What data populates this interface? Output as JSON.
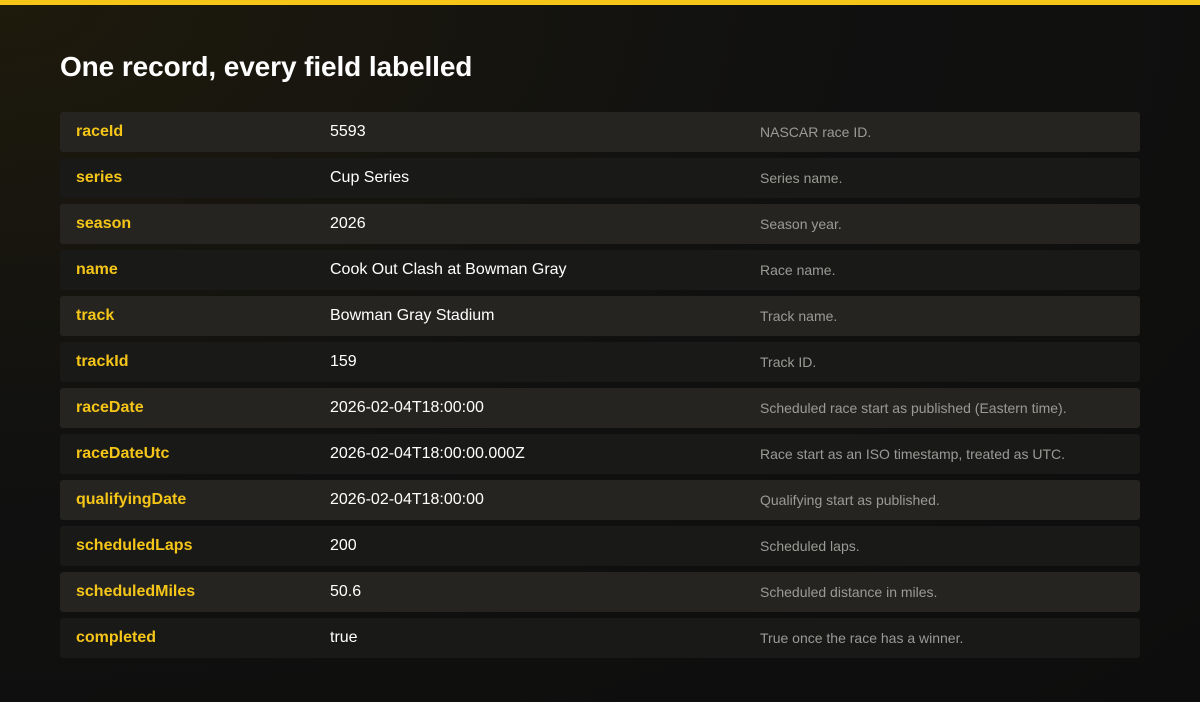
{
  "page": {
    "title": "One record, every field labelled",
    "accent_color": "#f5c518"
  },
  "record": {
    "rows": [
      {
        "key": "raceId",
        "value": "5593",
        "description": "NASCAR race ID."
      },
      {
        "key": "series",
        "value": "Cup Series",
        "description": "Series name."
      },
      {
        "key": "season",
        "value": "2026",
        "description": "Season year."
      },
      {
        "key": "name",
        "value": "Cook Out Clash at Bowman Gray",
        "description": "Race name."
      },
      {
        "key": "track",
        "value": "Bowman Gray Stadium",
        "description": "Track name."
      },
      {
        "key": "trackId",
        "value": "159",
        "description": "Track ID."
      },
      {
        "key": "raceDate",
        "value": "2026-02-04T18:00:00",
        "description": "Scheduled race start as published (Eastern time)."
      },
      {
        "key": "raceDateUtc",
        "value": "2026-02-04T18:00:00.000Z",
        "description": "Race start as an ISO timestamp, treated as UTC."
      },
      {
        "key": "qualifyingDate",
        "value": "2026-02-04T18:00:00",
        "description": "Qualifying start as published."
      },
      {
        "key": "scheduledLaps",
        "value": "200",
        "description": "Scheduled laps."
      },
      {
        "key": "scheduledMiles",
        "value": "50.6",
        "description": "Scheduled distance in miles."
      },
      {
        "key": "completed",
        "value": "true",
        "description": "True once the race has a winner."
      }
    ]
  }
}
